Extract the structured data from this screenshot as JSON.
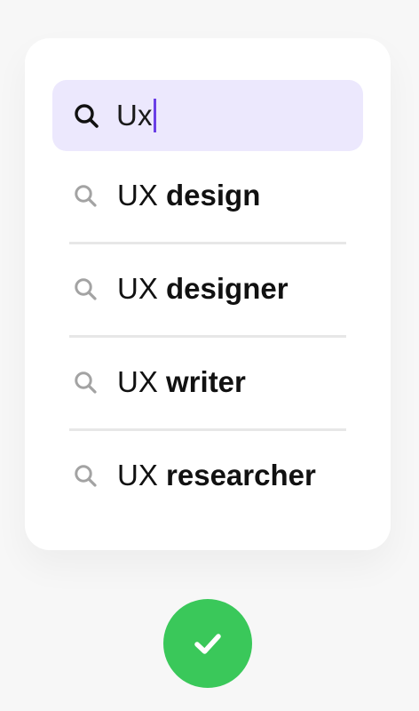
{
  "search": {
    "value": "Ux",
    "icon": "search-icon"
  },
  "suggestions": [
    {
      "prefix": "UX ",
      "completion": "design",
      "icon": "search-icon"
    },
    {
      "prefix": "UX ",
      "completion": "designer",
      "icon": "search-icon"
    },
    {
      "prefix": "UX ",
      "completion": "writer",
      "icon": "search-icon"
    },
    {
      "prefix": "UX ",
      "completion": "researcher",
      "icon": "search-icon"
    }
  ],
  "confirm": {
    "icon": "check-icon"
  },
  "colors": {
    "search_bg": "#ece8fd",
    "caret": "#6a3fe6",
    "confirm_bg": "#3ac85a",
    "suggestion_icon": "#a3a3a3"
  }
}
